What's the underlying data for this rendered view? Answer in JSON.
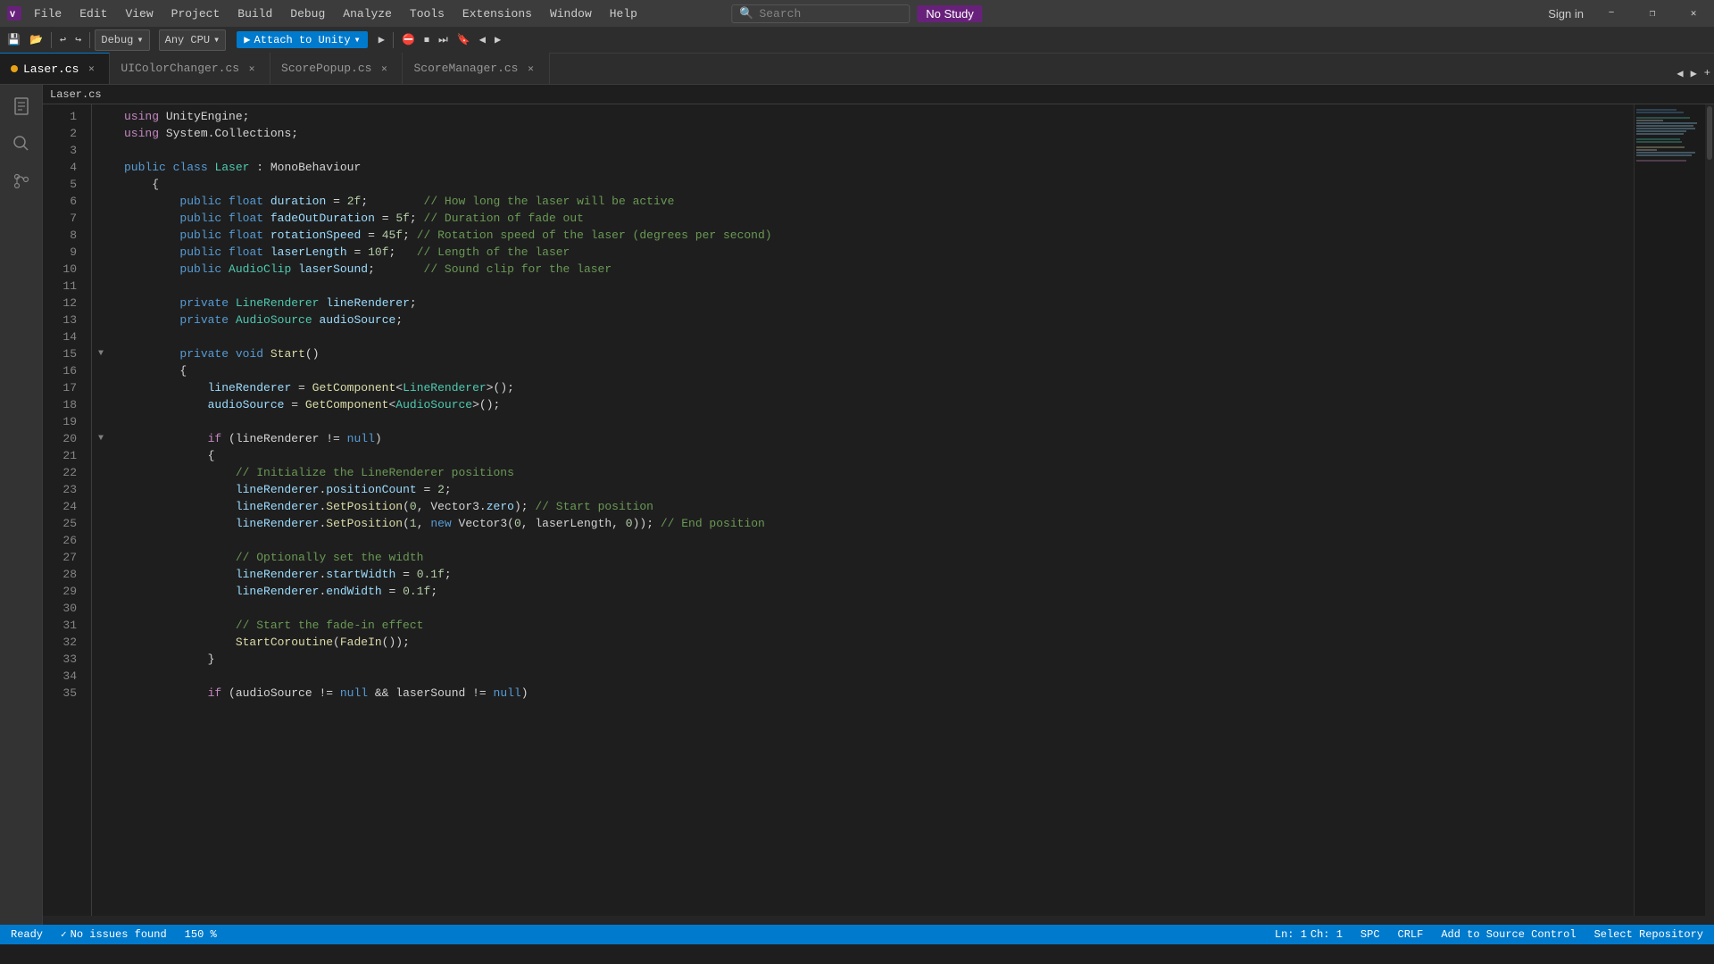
{
  "titlebar": {
    "menu_items": [
      "File",
      "Edit",
      "View",
      "Project",
      "Build",
      "Debug",
      "Analyze",
      "Tools",
      "Extensions",
      "Window",
      "Help"
    ],
    "search_placeholder": "Search",
    "no_study_label": "No Study",
    "sign_in_label": "Sign in",
    "window_minimize": "−",
    "window_restore": "❐",
    "window_close": "✕"
  },
  "toolbar": {
    "debug_config": "Debug",
    "platform": "Any CPU",
    "play_label": "Attach to Unity",
    "undo_label": "Undo",
    "redo_label": "Redo"
  },
  "tabs": [
    {
      "label": "Laser.cs",
      "active": true,
      "modified": true
    },
    {
      "label": "UIColorChanger.cs",
      "active": false,
      "modified": false
    },
    {
      "label": "ScorePopup.cs",
      "active": false,
      "modified": false
    },
    {
      "label": "ScoreManager.cs",
      "active": false,
      "modified": false
    }
  ],
  "breadcrumb": "Laser.cs",
  "code": {
    "lines": [
      {
        "num": 1,
        "tokens": [
          {
            "t": "kw2",
            "v": "using"
          },
          {
            "t": "plain",
            "v": " UnityEngine;"
          }
        ]
      },
      {
        "num": 2,
        "tokens": [
          {
            "t": "kw2",
            "v": "using"
          },
          {
            "t": "plain",
            "v": " System.Collections;"
          }
        ]
      },
      {
        "num": 3,
        "tokens": []
      },
      {
        "num": 4,
        "tokens": [
          {
            "t": "kw",
            "v": "public"
          },
          {
            "t": "plain",
            "v": " "
          },
          {
            "t": "kw",
            "v": "class"
          },
          {
            "t": "plain",
            "v": " "
          },
          {
            "t": "type",
            "v": "Laser"
          },
          {
            "t": "plain",
            "v": " : MonoBehaviour"
          }
        ]
      },
      {
        "num": 5,
        "tokens": [
          {
            "t": "plain",
            "v": "    {"
          }
        ]
      },
      {
        "num": 6,
        "tokens": [
          {
            "t": "plain",
            "v": "        "
          },
          {
            "t": "kw",
            "v": "public"
          },
          {
            "t": "plain",
            "v": " "
          },
          {
            "t": "kw",
            "v": "float"
          },
          {
            "t": "plain",
            "v": " "
          },
          {
            "t": "var",
            "v": "duration"
          },
          {
            "t": "plain",
            "v": " = "
          },
          {
            "t": "num",
            "v": "2f"
          },
          {
            "t": "plain",
            "v": ";        "
          },
          {
            "t": "cmt",
            "v": "// How long the laser will be active"
          }
        ]
      },
      {
        "num": 7,
        "tokens": [
          {
            "t": "plain",
            "v": "        "
          },
          {
            "t": "kw",
            "v": "public"
          },
          {
            "t": "plain",
            "v": " "
          },
          {
            "t": "kw",
            "v": "float"
          },
          {
            "t": "plain",
            "v": " "
          },
          {
            "t": "var",
            "v": "fadeOutDuration"
          },
          {
            "t": "plain",
            "v": " = "
          },
          {
            "t": "num",
            "v": "5f"
          },
          {
            "t": "plain",
            "v": "; "
          },
          {
            "t": "cmt",
            "v": "// Duration of fade out"
          }
        ]
      },
      {
        "num": 8,
        "tokens": [
          {
            "t": "plain",
            "v": "        "
          },
          {
            "t": "kw",
            "v": "public"
          },
          {
            "t": "plain",
            "v": " "
          },
          {
            "t": "kw",
            "v": "float"
          },
          {
            "t": "plain",
            "v": " "
          },
          {
            "t": "var",
            "v": "rotationSpeed"
          },
          {
            "t": "plain",
            "v": " = "
          },
          {
            "t": "num",
            "v": "45f"
          },
          {
            "t": "plain",
            "v": "; "
          },
          {
            "t": "cmt",
            "v": "// Rotation speed of the laser (degrees per second)"
          }
        ]
      },
      {
        "num": 9,
        "tokens": [
          {
            "t": "plain",
            "v": "        "
          },
          {
            "t": "kw",
            "v": "public"
          },
          {
            "t": "plain",
            "v": " "
          },
          {
            "t": "kw",
            "v": "float"
          },
          {
            "t": "plain",
            "v": " "
          },
          {
            "t": "var",
            "v": "laserLength"
          },
          {
            "t": "plain",
            "v": " = "
          },
          {
            "t": "num",
            "v": "10f"
          },
          {
            "t": "plain",
            "v": ";   "
          },
          {
            "t": "cmt",
            "v": "// Length of the laser"
          }
        ]
      },
      {
        "num": 10,
        "tokens": [
          {
            "t": "plain",
            "v": "        "
          },
          {
            "t": "kw",
            "v": "public"
          },
          {
            "t": "plain",
            "v": " "
          },
          {
            "t": "type",
            "v": "AudioClip"
          },
          {
            "t": "plain",
            "v": " "
          },
          {
            "t": "var",
            "v": "laserSound"
          },
          {
            "t": "plain",
            "v": ";       "
          },
          {
            "t": "cmt",
            "v": "// Sound clip for the laser"
          }
        ]
      },
      {
        "num": 11,
        "tokens": []
      },
      {
        "num": 12,
        "tokens": [
          {
            "t": "plain",
            "v": "        "
          },
          {
            "t": "kw",
            "v": "private"
          },
          {
            "t": "plain",
            "v": " "
          },
          {
            "t": "type",
            "v": "LineRenderer"
          },
          {
            "t": "plain",
            "v": " "
          },
          {
            "t": "var",
            "v": "lineRenderer"
          },
          {
            "t": "plain",
            "v": ";"
          }
        ]
      },
      {
        "num": 13,
        "tokens": [
          {
            "t": "plain",
            "v": "        "
          },
          {
            "t": "kw",
            "v": "private"
          },
          {
            "t": "plain",
            "v": " "
          },
          {
            "t": "type",
            "v": "AudioSource"
          },
          {
            "t": "plain",
            "v": " "
          },
          {
            "t": "var",
            "v": "audioSource"
          },
          {
            "t": "plain",
            "v": ";"
          }
        ]
      },
      {
        "num": 14,
        "tokens": []
      },
      {
        "num": 15,
        "tokens": [
          {
            "t": "plain",
            "v": "        "
          },
          {
            "t": "kw",
            "v": "private"
          },
          {
            "t": "plain",
            "v": " "
          },
          {
            "t": "kw",
            "v": "void"
          },
          {
            "t": "plain",
            "v": " "
          },
          {
            "t": "fn",
            "v": "Start"
          },
          {
            "t": "plain",
            "v": "()"
          }
        ],
        "collapsible": true
      },
      {
        "num": 16,
        "tokens": [
          {
            "t": "plain",
            "v": "        {"
          }
        ]
      },
      {
        "num": 17,
        "tokens": [
          {
            "t": "plain",
            "v": "            "
          },
          {
            "t": "var",
            "v": "lineRenderer"
          },
          {
            "t": "plain",
            "v": " = "
          },
          {
            "t": "fn",
            "v": "GetComponent"
          },
          {
            "t": "plain",
            "v": "<"
          },
          {
            "t": "type",
            "v": "LineRenderer"
          },
          {
            "t": "plain",
            "v": ">();"
          }
        ]
      },
      {
        "num": 18,
        "tokens": [
          {
            "t": "plain",
            "v": "            "
          },
          {
            "t": "var",
            "v": "audioSource"
          },
          {
            "t": "plain",
            "v": " = "
          },
          {
            "t": "fn",
            "v": "GetComponent"
          },
          {
            "t": "plain",
            "v": "<"
          },
          {
            "t": "type",
            "v": "AudioSource"
          },
          {
            "t": "plain",
            "v": ">();"
          }
        ]
      },
      {
        "num": 19,
        "tokens": []
      },
      {
        "num": 20,
        "tokens": [
          {
            "t": "plain",
            "v": "            "
          },
          {
            "t": "kw2",
            "v": "if"
          },
          {
            "t": "plain",
            "v": " (lineRenderer != "
          },
          {
            "t": "kw",
            "v": "null"
          },
          {
            "t": "plain",
            "v": ")"
          }
        ],
        "collapsible": true
      },
      {
        "num": 21,
        "tokens": [
          {
            "t": "plain",
            "v": "            {"
          }
        ]
      },
      {
        "num": 22,
        "tokens": [
          {
            "t": "plain",
            "v": "                "
          },
          {
            "t": "cmt",
            "v": "// Initialize the LineRenderer positions"
          }
        ]
      },
      {
        "num": 23,
        "tokens": [
          {
            "t": "plain",
            "v": "                "
          },
          {
            "t": "var",
            "v": "lineRenderer"
          },
          {
            "t": "plain",
            "v": "."
          },
          {
            "t": "prop",
            "v": "positionCount"
          },
          {
            "t": "plain",
            "v": " = "
          },
          {
            "t": "num",
            "v": "2"
          },
          {
            "t": "plain",
            "v": ";"
          }
        ]
      },
      {
        "num": 24,
        "tokens": [
          {
            "t": "plain",
            "v": "                "
          },
          {
            "t": "var",
            "v": "lineRenderer"
          },
          {
            "t": "plain",
            "v": "."
          },
          {
            "t": "fn",
            "v": "SetPosition"
          },
          {
            "t": "plain",
            "v": "("
          },
          {
            "t": "num",
            "v": "0"
          },
          {
            "t": "plain",
            "v": ", Vector3."
          },
          {
            "t": "prop",
            "v": "zero"
          },
          {
            "t": "plain",
            "v": "); "
          },
          {
            "t": "cmt",
            "v": "// Start position"
          }
        ]
      },
      {
        "num": 25,
        "tokens": [
          {
            "t": "plain",
            "v": "                "
          },
          {
            "t": "var",
            "v": "lineRenderer"
          },
          {
            "t": "plain",
            "v": "."
          },
          {
            "t": "fn",
            "v": "SetPosition"
          },
          {
            "t": "plain",
            "v": "("
          },
          {
            "t": "num",
            "v": "1"
          },
          {
            "t": "plain",
            "v": ", "
          },
          {
            "t": "kw",
            "v": "new"
          },
          {
            "t": "plain",
            "v": " Vector3("
          },
          {
            "t": "num",
            "v": "0"
          },
          {
            "t": "plain",
            "v": ", laserLength, "
          },
          {
            "t": "num",
            "v": "0"
          },
          {
            "t": "plain",
            "v": ")); "
          },
          {
            "t": "cmt",
            "v": "// End position"
          }
        ]
      },
      {
        "num": 26,
        "tokens": []
      },
      {
        "num": 27,
        "tokens": [
          {
            "t": "plain",
            "v": "                "
          },
          {
            "t": "cmt",
            "v": "// Optionally set the width"
          }
        ]
      },
      {
        "num": 28,
        "tokens": [
          {
            "t": "plain",
            "v": "                "
          },
          {
            "t": "var",
            "v": "lineRenderer"
          },
          {
            "t": "plain",
            "v": "."
          },
          {
            "t": "prop",
            "v": "startWidth"
          },
          {
            "t": "plain",
            "v": " = "
          },
          {
            "t": "num",
            "v": "0.1f"
          },
          {
            "t": "plain",
            "v": ";"
          }
        ]
      },
      {
        "num": 29,
        "tokens": [
          {
            "t": "plain",
            "v": "                "
          },
          {
            "t": "var",
            "v": "lineRenderer"
          },
          {
            "t": "plain",
            "v": "."
          },
          {
            "t": "prop",
            "v": "endWidth"
          },
          {
            "t": "plain",
            "v": " = "
          },
          {
            "t": "num",
            "v": "0.1f"
          },
          {
            "t": "plain",
            "v": ";"
          }
        ]
      },
      {
        "num": 30,
        "tokens": []
      },
      {
        "num": 31,
        "tokens": [
          {
            "t": "plain",
            "v": "                "
          },
          {
            "t": "cmt",
            "v": "// Start the fade-in effect"
          }
        ]
      },
      {
        "num": 32,
        "tokens": [
          {
            "t": "plain",
            "v": "                "
          },
          {
            "t": "fn",
            "v": "StartCoroutine"
          },
          {
            "t": "plain",
            "v": "("
          },
          {
            "t": "fn",
            "v": "FadeIn"
          },
          {
            "t": "plain",
            "v": "());"
          }
        ]
      },
      {
        "num": 33,
        "tokens": [
          {
            "t": "plain",
            "v": "            }"
          }
        ]
      },
      {
        "num": 34,
        "tokens": []
      },
      {
        "num": 35,
        "tokens": [
          {
            "t": "plain",
            "v": "            "
          },
          {
            "t": "kw2",
            "v": "if"
          },
          {
            "t": "plain",
            "v": " (audioSource != "
          },
          {
            "t": "kw",
            "v": "null"
          },
          {
            "t": "plain",
            "v": " && laserSound != "
          },
          {
            "t": "kw",
            "v": "null"
          },
          {
            "t": "plain",
            "v": ")"
          }
        ]
      }
    ]
  },
  "statusbar": {
    "ready_label": "Ready",
    "no_issues": "No issues found",
    "ln": "Ln: 1",
    "ch": "Ch: 1",
    "spaces": "SPC",
    "encoding": "CRLF",
    "add_to_source": "Add to Source Control",
    "select_repo": "Select Repository",
    "zoom": "150 %"
  }
}
